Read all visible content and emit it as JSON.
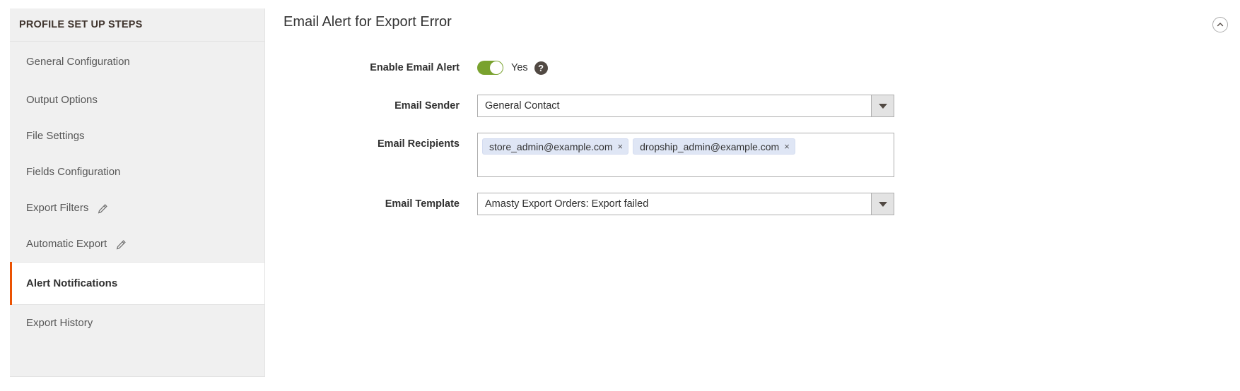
{
  "sidebar": {
    "header": "PROFILE SET UP STEPS",
    "items": [
      {
        "label": "General Configuration",
        "edit_icon": false,
        "active": false
      },
      {
        "label": "Output Options",
        "edit_icon": false,
        "active": false
      },
      {
        "label": "File Settings",
        "edit_icon": false,
        "active": false
      },
      {
        "label": "Fields Configuration",
        "edit_icon": false,
        "active": false
      },
      {
        "label": "Export Filters",
        "edit_icon": true,
        "active": false
      },
      {
        "label": "Automatic Export",
        "edit_icon": true,
        "active": false
      },
      {
        "label": "Alert Notifications",
        "edit_icon": false,
        "active": true
      },
      {
        "label": "Export History",
        "edit_icon": false,
        "active": false
      }
    ],
    "active_accent_color": "#eb5202",
    "edit_icon_name": "pencil-icon"
  },
  "section": {
    "title": "Email Alert for Export Error",
    "collapse_icon": "chevron-up-icon"
  },
  "form": {
    "enable_email_alert": {
      "label": "Enable Email Alert",
      "toggle_state": "on",
      "toggle_text": "Yes",
      "toggle_color": "#79a22e",
      "help_icon": "question-mark-icon",
      "help_glyph": "?"
    },
    "email_sender": {
      "label": "Email Sender",
      "value": "General Contact",
      "dropdown_icon": "caret-down-icon"
    },
    "email_recipients": {
      "label": "Email Recipients",
      "tags": [
        {
          "value": "store_admin@example.com",
          "remove_glyph": "×"
        },
        {
          "value": "dropship_admin@example.com",
          "remove_glyph": "×"
        }
      ]
    },
    "email_template": {
      "label": "Email Template",
      "value": "Amasty Export Orders: Export failed",
      "dropdown_icon": "caret-down-icon"
    }
  }
}
